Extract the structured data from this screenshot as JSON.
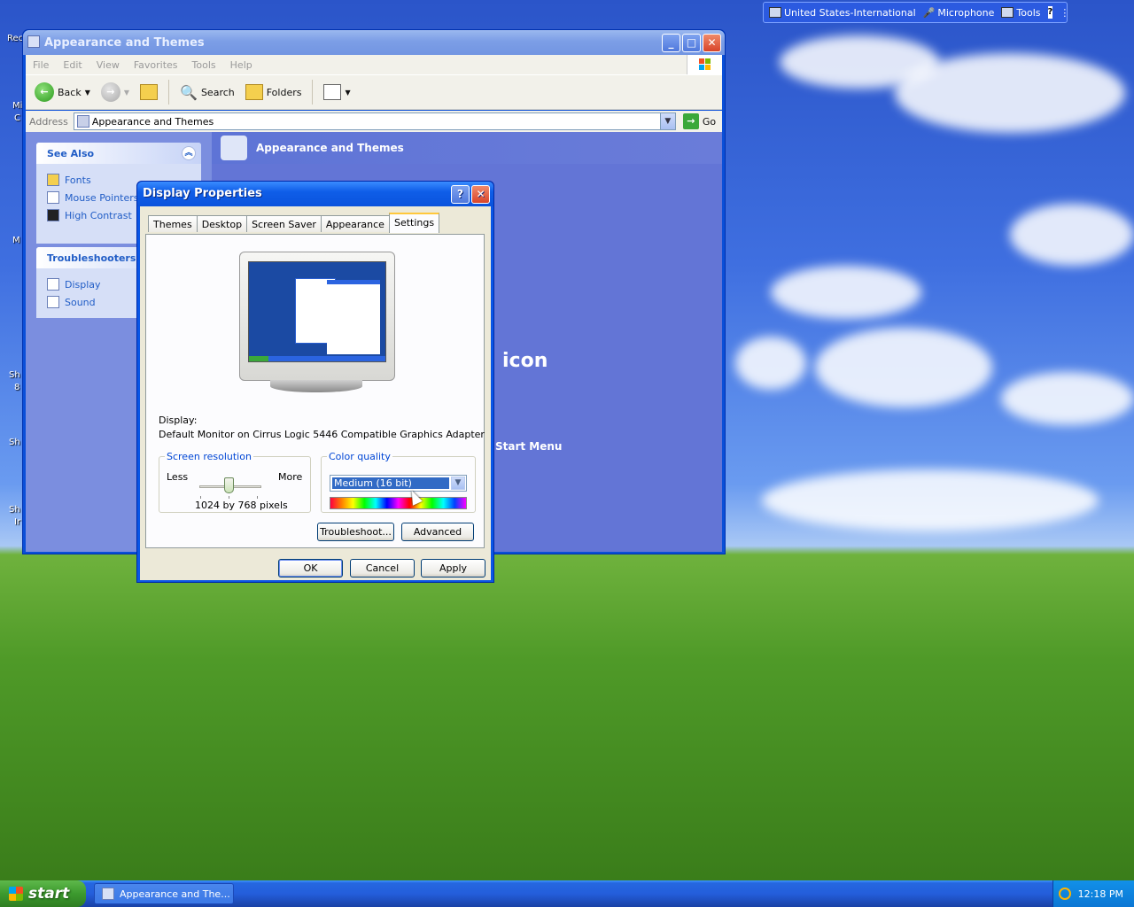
{
  "desktop": {
    "recycle_label": "Rec",
    "partial_labels": [
      "Mi",
      "C",
      "M",
      "Sh",
      "8",
      "Sh",
      "Sh",
      "Ir"
    ]
  },
  "language_bar": {
    "language": "United States-International",
    "microphone": "Microphone",
    "tools": "Tools",
    "help": "?"
  },
  "explorer": {
    "title": "Appearance and Themes",
    "menu": [
      "File",
      "Edit",
      "View",
      "Favorites",
      "Tools",
      "Help"
    ],
    "toolbar": {
      "back": "Back",
      "search": "Search",
      "folders": "Folders"
    },
    "address_label": "Address",
    "address_value": "Appearance and Themes",
    "go": "Go",
    "see_also": {
      "title": "See Also",
      "items": [
        "Fonts",
        "Mouse Pointers",
        "High Contrast"
      ]
    },
    "troubleshooters": {
      "title": "Troubleshooters",
      "items": [
        "Display",
        "Sound"
      ]
    },
    "content_title": "Appearance and Themes",
    "partial_bg_text": [
      "icon",
      "Start Menu"
    ]
  },
  "dialog": {
    "title": "Display Properties",
    "tabs": [
      "Themes",
      "Desktop",
      "Screen Saver",
      "Appearance",
      "Settings"
    ],
    "active_tab": "Settings",
    "display_label": "Display:",
    "display_value": "Default Monitor on Cirrus Logic 5446 Compatible Graphics Adapter",
    "screen_resolution": {
      "legend": "Screen resolution",
      "less": "Less",
      "more": "More",
      "value": "1024 by 768 pixels"
    },
    "color_quality": {
      "legend": "Color quality",
      "selected": "Medium (16 bit)"
    },
    "buttons": {
      "troubleshoot": "Troubleshoot...",
      "advanced": "Advanced",
      "ok": "OK",
      "cancel": "Cancel",
      "apply": "Apply"
    }
  },
  "taskbar": {
    "start": "start",
    "task_item": "Appearance and The...",
    "clock": "12:18 PM"
  }
}
